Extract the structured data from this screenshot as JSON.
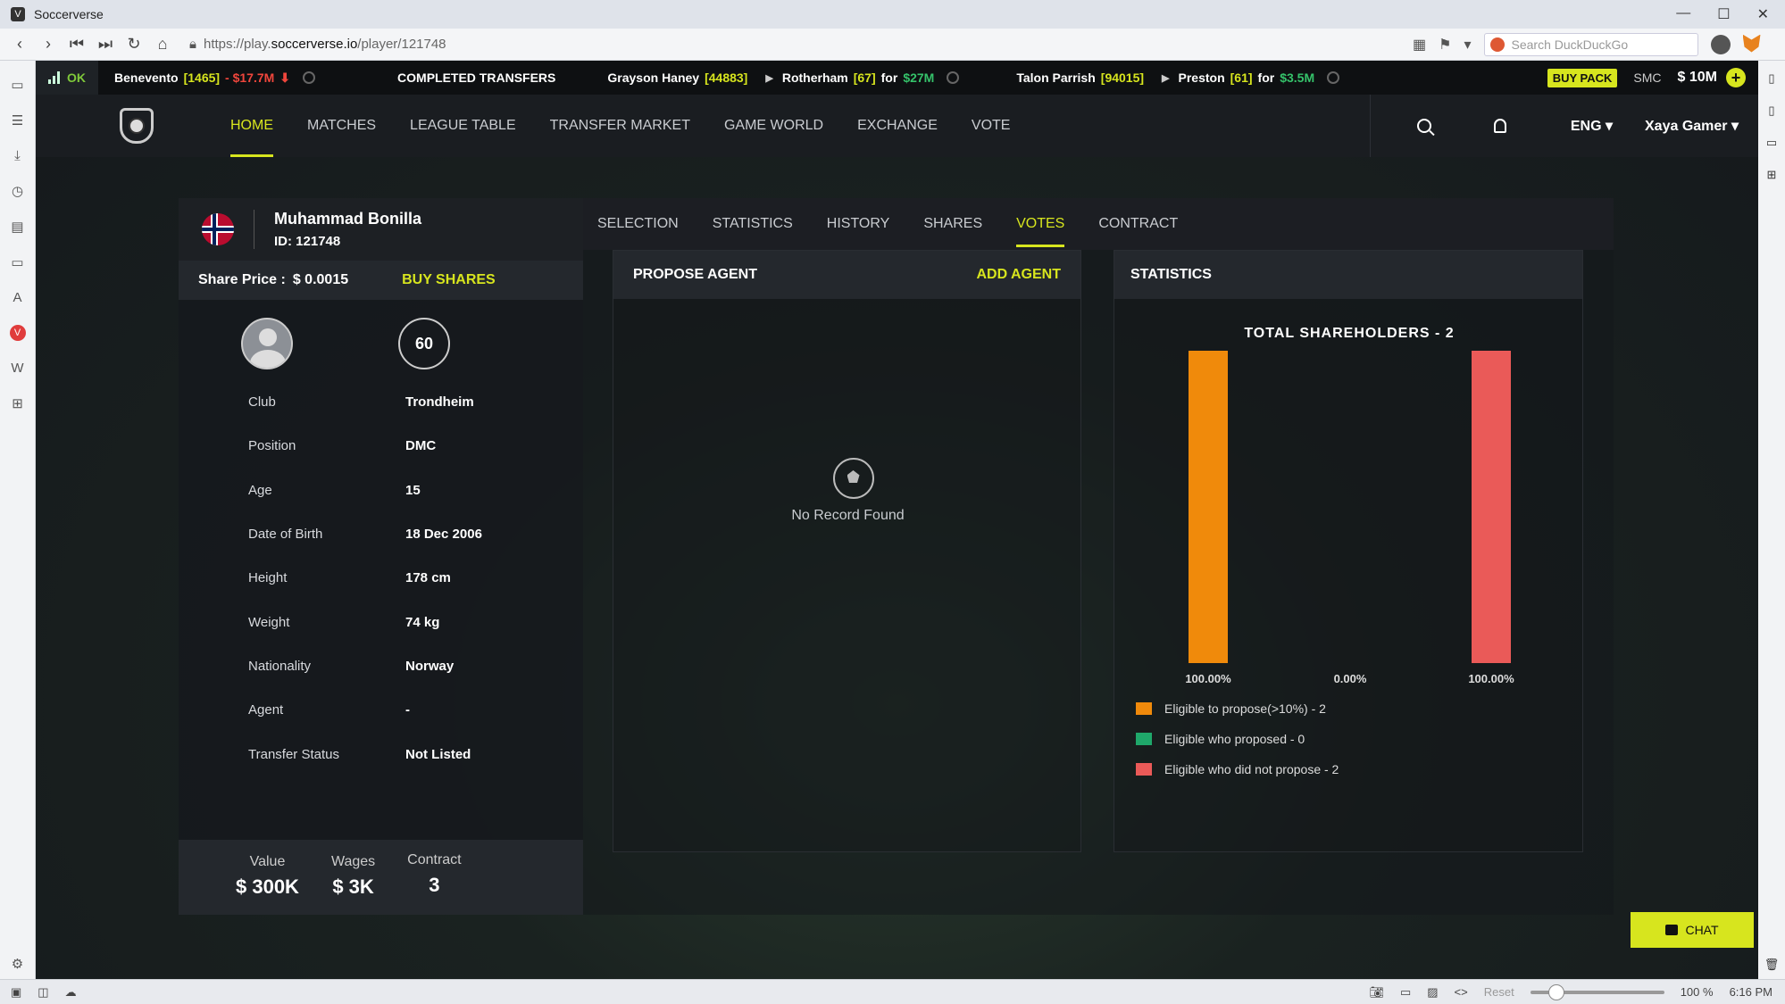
{
  "browser": {
    "window_title": "Soccerverse",
    "url_prefix": "https://play.",
    "url_domain": "soccerverse.io",
    "url_path": "/player/121748",
    "search_placeholder": "Search DuckDuckGo",
    "zoom_reset": "Reset",
    "zoom_level": "100 %",
    "clock": "6:16 PM"
  },
  "ticker": {
    "status": "OK",
    "item1_club": "Benevento",
    "item1_id": "[1465]",
    "item1_change": "- $17.7M",
    "completed_label": "COMPLETED TRANSFERS",
    "t1_player": "Grayson Haney",
    "t1_id": "[44883]",
    "t1_club": "Rotherham",
    "t1_rating": "[67]",
    "t1_for": "for",
    "t1_amount": "$27M",
    "t2_player": "Talon Parrish",
    "t2_id": "[94015]",
    "t2_club": "Preston",
    "t2_rating": "[61]",
    "t2_for": "for",
    "t2_amount": "$3.5M",
    "buy_pack": "BUY PACK",
    "smc": "SMC",
    "balance": "$ 10M"
  },
  "nav": {
    "items": [
      "HOME",
      "MATCHES",
      "LEAGUE TABLE",
      "TRANSFER MARKET",
      "GAME WORLD",
      "EXCHANGE",
      "VOTE"
    ],
    "lang": "ENG",
    "user": "Xaya Gamer"
  },
  "player": {
    "name": "Muhammad Bonilla",
    "id_text": "ID: 121748",
    "share_price_label": "Share Price :",
    "share_price": "$ 0.0015",
    "buy_shares": "BUY SHARES",
    "rating": "60",
    "info": [
      {
        "label": "Club",
        "value": "Trondheim"
      },
      {
        "label": "Position",
        "value": "DMC"
      },
      {
        "label": "Age",
        "value": "15"
      },
      {
        "label": "Date of Birth",
        "value": "18 Dec 2006"
      },
      {
        "label": "Height",
        "value": "178 cm"
      },
      {
        "label": "Weight",
        "value": "74 kg"
      },
      {
        "label": "Nationality",
        "value": "Norway"
      },
      {
        "label": "Agent",
        "value": "-"
      },
      {
        "label": "Transfer Status",
        "value": "Not Listed"
      }
    ],
    "footer": {
      "value_label": "Value",
      "value": "$ 300K",
      "wages_label": "Wages",
      "wages": "$ 3K",
      "contract_label": "Contract",
      "contract": "3"
    }
  },
  "tabs": [
    "SELECTION",
    "STATISTICS",
    "HISTORY",
    "SHARES",
    "VOTES",
    "CONTRACT"
  ],
  "propose": {
    "title": "PROPOSE AGENT",
    "add": "ADD AGENT",
    "empty": "No Record Found"
  },
  "stats": {
    "title": "STATISTICS"
  },
  "chart_data": {
    "type": "bar",
    "title": "TOTAL SHAREHOLDERS - 2",
    "categories": [
      "100.00%",
      "0.00%",
      "100.00%"
    ],
    "values": [
      100,
      0,
      100
    ],
    "colors": [
      "#f08a0b",
      "#1fa86a",
      "#ea5a58"
    ],
    "ylim": [
      0,
      100
    ],
    "grid": false,
    "legend_position": "bottom-left",
    "legend": [
      {
        "label": "Eligible to propose(>10%) - 2",
        "color": "#f08a0b"
      },
      {
        "label": "Eligible who proposed - 0",
        "color": "#1fa86a"
      },
      {
        "label": "Eligible who did not propose - 2",
        "color": "#ea5a58"
      }
    ]
  },
  "chat": "CHAT"
}
